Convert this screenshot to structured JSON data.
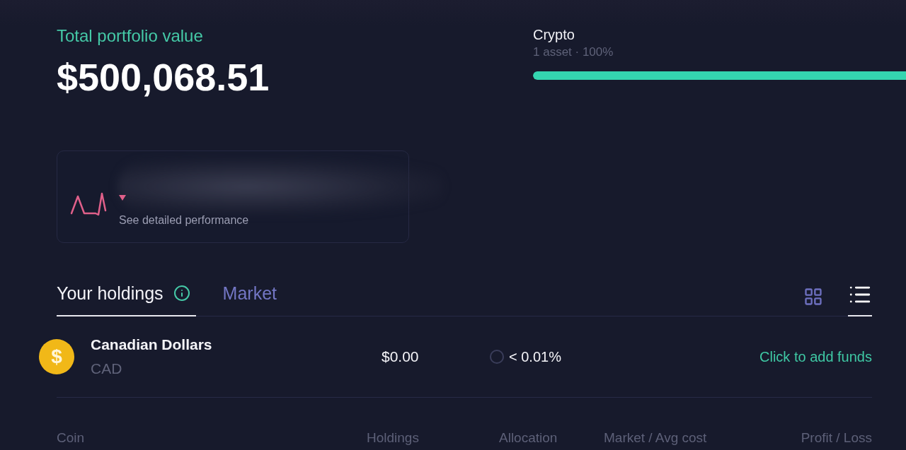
{
  "portfolio": {
    "label": "Total portfolio value",
    "value": "$500,068.51"
  },
  "allocation": {
    "name": "Crypto",
    "detail": "1 asset · 100%",
    "level": 1
  },
  "performance": {
    "negative": true,
    "link": "See detailed performance"
  },
  "tabs": [
    {
      "label": "Your holdings",
      "selected": true,
      "info": true
    },
    {
      "label": "Market",
      "selected": false,
      "info": false
    }
  ],
  "view_toggle": [
    {
      "kind": "grid",
      "selected": false
    },
    {
      "kind": "list",
      "selected": true
    }
  ],
  "holdings": [
    {
      "name": "Canadian Dollars",
      "symbol": "CAD",
      "badge": "$",
      "holdings": "$0.00",
      "allocation": "< 0.01%",
      "action": "Click to add funds"
    }
  ],
  "columns": [
    "Coin",
    "Holdings",
    "Allocation",
    "Market / Avg cost",
    "Profit / Loss"
  ]
}
